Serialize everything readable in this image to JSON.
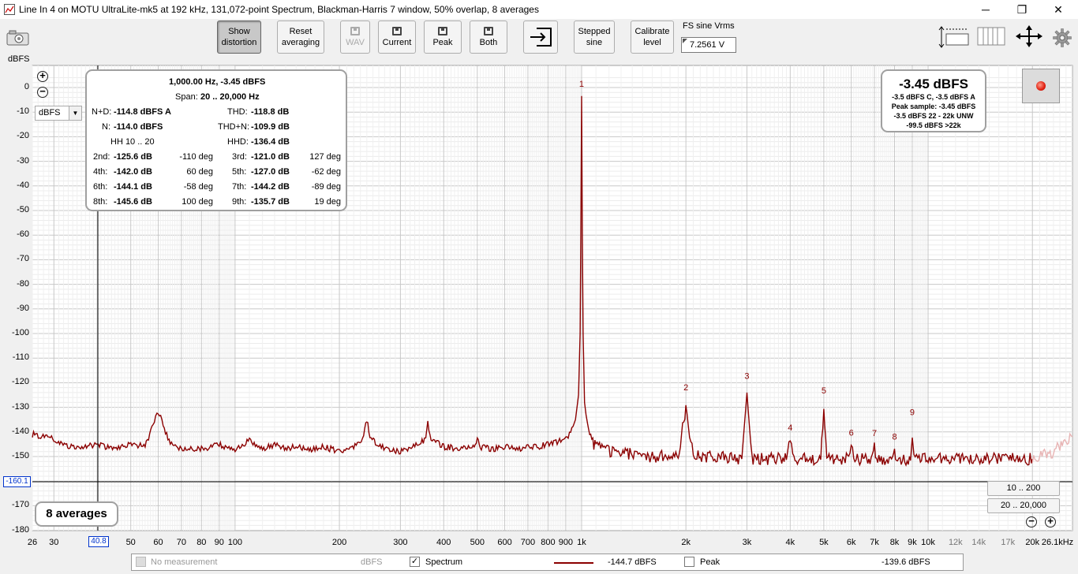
{
  "window": {
    "title": "Line In 4 on MOTU UltraLite-mk5 at 192 kHz, 131,072-point Spectrum, Blackman-Harris 7 window, 50% overlap, 8 averages",
    "minimize_glyph": "─",
    "restore_glyph": "❐",
    "close_glyph": "✕"
  },
  "toolbar": {
    "show_distortion": "Show\ndistortion",
    "reset_averaging": "Reset\naveraging",
    "wav": "WAV",
    "current": "Current",
    "peak": "Peak",
    "both": "Both",
    "stepped_sine": "Stepped\nsine",
    "calibrate_level": "Calibrate\nlevel",
    "fs_label": "FS sine Vrms",
    "fs_value": "7.2561 V",
    "icons": [
      "camera-icon",
      "disk-icon",
      "import-icon",
      "resize-icon",
      "columns-icon",
      "expand-arrows-icon",
      "gear-icon"
    ]
  },
  "plot": {
    "y_unit": "dBFS",
    "unit_select": "dBFS",
    "y_ticks": [
      "0",
      "-10",
      "-20",
      "-30",
      "-40",
      "-50",
      "-60",
      "-70",
      "-80",
      "-90",
      "-100",
      "-110",
      "-120",
      "-130",
      "-140",
      "-150",
      "-160",
      "-170",
      "-180"
    ],
    "x_ticks_major": [
      "26",
      "30",
      "50",
      "60",
      "70",
      "80",
      "90",
      "100",
      "200",
      "300",
      "400",
      "500",
      "600",
      "700",
      "800",
      "900",
      "1k",
      "2k",
      "3k",
      "4k",
      "5k",
      "6k",
      "7k",
      "8k",
      "9k",
      "10k",
      "20k",
      "26.1kHz"
    ],
    "x_ticks_minor": [
      "12k",
      "14k",
      "17k"
    ],
    "cursor_y": "-160.1",
    "cursor_x": "40.8",
    "averages_label": "8 averages",
    "range_10_200": "10 .. 200",
    "range_20_20000": "20 .. 20,000"
  },
  "info_panel": {
    "header": "1,000.00 Hz, -3.45 dBFS",
    "span_label": "Span:",
    "span_value": "20 .. 20,000 Hz",
    "nd_label": "N+D:",
    "nd_value": "-114.8 dBFS A",
    "thd_label": "THD:",
    "thd_value": "-118.8 dB",
    "n_label": "N:",
    "n_value": "-114.0 dBFS",
    "thdn_label": "THD+N:",
    "thdn_value": "-109.9 dB",
    "hh_label": "HH 10 .. 20",
    "hhd_label": "HHD:",
    "hhd_value": "-136.4 dB",
    "harmonics": [
      {
        "l1": "2nd:",
        "v1": "-125.6 dB",
        "p1": "-110 deg",
        "l2": "3rd:",
        "v2": "-121.0 dB",
        "p2": "127 deg"
      },
      {
        "l1": "4th:",
        "v1": "-142.0 dB",
        "p1": "60 deg",
        "l2": "5th:",
        "v2": "-127.0 dB",
        "p2": "-62 deg"
      },
      {
        "l1": "6th:",
        "v1": "-144.1 dB",
        "p1": "-58 deg",
        "l2": "7th:",
        "v2": "-144.2 dB",
        "p2": "-89 deg"
      },
      {
        "l1": "8th:",
        "v1": "-145.6 dB",
        "p1": "100 deg",
        "l2": "9th:",
        "v2": "-135.7 dB",
        "p2": "19 deg"
      }
    ]
  },
  "level_panel": {
    "big": "-3.45 dBFS",
    "line1": "-3.5 dBFS C, -3.5 dBFS A",
    "line2": "Peak sample: -3.45 dBFS",
    "line3": "-3.5 dBFS 22 - 22k UNW",
    "line4": "-99.5 dBFS >22k"
  },
  "legend": {
    "no_measurement": "No measurement",
    "unit1": "dBFS",
    "spectrum": "Spectrum",
    "spectrum_value": "-144.7 dBFS",
    "peak": "Peak",
    "peak_value": "-139.6 dBFS",
    "spectrum_checked": "✓"
  },
  "colors": {
    "trace": "#8b0000",
    "trace_extended": "#e8b4b4",
    "harmonic_label": "#8b0000",
    "cursor": "#0033cc"
  },
  "chart_data": {
    "type": "line",
    "xscale": "log",
    "xlim": [
      26,
      26100
    ],
    "ylim": [
      -180,
      5
    ],
    "grid": true,
    "fundamental": {
      "x": 1000,
      "y": -3.45,
      "label": "1"
    },
    "harmonic_markers": [
      {
        "label": "2",
        "x": 2000,
        "y": -125.6
      },
      {
        "label": "3",
        "x": 3000,
        "y": -121.0
      },
      {
        "label": "4",
        "x": 4000,
        "y": -142.0
      },
      {
        "label": "5",
        "x": 5000,
        "y": -127.0
      },
      {
        "label": "6",
        "x": 6000,
        "y": -144.1
      },
      {
        "label": "7",
        "x": 7000,
        "y": -144.2
      },
      {
        "label": "8",
        "x": 8000,
        "y": -145.6
      },
      {
        "label": "9",
        "x": 9000,
        "y": -135.7
      }
    ],
    "series": [
      {
        "name": "Spectrum",
        "x": [
          26,
          30,
          35,
          40,
          45,
          50,
          55,
          58,
          60,
          62,
          65,
          70,
          80,
          90,
          100,
          110,
          120,
          130,
          140,
          150,
          160,
          170,
          180,
          200,
          220,
          235,
          240,
          245,
          260,
          280,
          300,
          330,
          355,
          360,
          365,
          400,
          450,
          490,
          500,
          510,
          550,
          600,
          650,
          700,
          750,
          800,
          850,
          900,
          930,
          960,
          980,
          990,
          995,
          1000,
          1005,
          1010,
          1020,
          1040,
          1070,
          1100,
          1200,
          1400,
          1600,
          1900,
          2000,
          2100,
          2500,
          2900,
          3000,
          3100,
          3500,
          3900,
          4000,
          4100,
          4500,
          4900,
          5000,
          5100,
          5500,
          5900,
          6000,
          6100,
          6500,
          6900,
          7000,
          7100,
          7500,
          7900,
          8000,
          8100,
          8500,
          8900,
          9000,
          9100,
          9500,
          10000,
          12000,
          14000,
          17000,
          20000
        ],
        "y": [
          -141,
          -143,
          -147,
          -145,
          -147,
          -145,
          -146,
          -137,
          -132,
          -137,
          -145,
          -147,
          -147,
          -145,
          -148,
          -143,
          -147,
          -145,
          -147,
          -146,
          -147,
          -147,
          -146,
          -148,
          -146,
          -142,
          -135,
          -142,
          -146,
          -147,
          -148,
          -146,
          -143,
          -136,
          -142,
          -146,
          -147,
          -146,
          -143,
          -146,
          -147,
          -146,
          -147,
          -146,
          -146,
          -145,
          -144,
          -143,
          -140,
          -135,
          -125,
          -100,
          -60,
          -3.45,
          -60,
          -100,
          -128,
          -138,
          -144,
          -146,
          -148,
          -149,
          -150,
          -150,
          -130,
          -150,
          -150,
          -151,
          -124,
          -151,
          -151,
          -151,
          -143,
          -151,
          -151,
          -151,
          -130,
          -151,
          -151,
          -151,
          -145,
          -151,
          -151,
          -151,
          -146,
          -151,
          -151,
          -151,
          -148,
          -151,
          -151,
          -151,
          -140,
          -151,
          -151,
          -151,
          -151,
          -151,
          -151,
          -151
        ]
      },
      {
        "name": "Spectrum (>20k)",
        "x": [
          20000,
          21000,
          22000,
          23000,
          24000,
          25000,
          26100
        ],
        "y": [
          -151,
          -150,
          -149,
          -148,
          -146,
          -144,
          -142
        ]
      }
    ]
  }
}
